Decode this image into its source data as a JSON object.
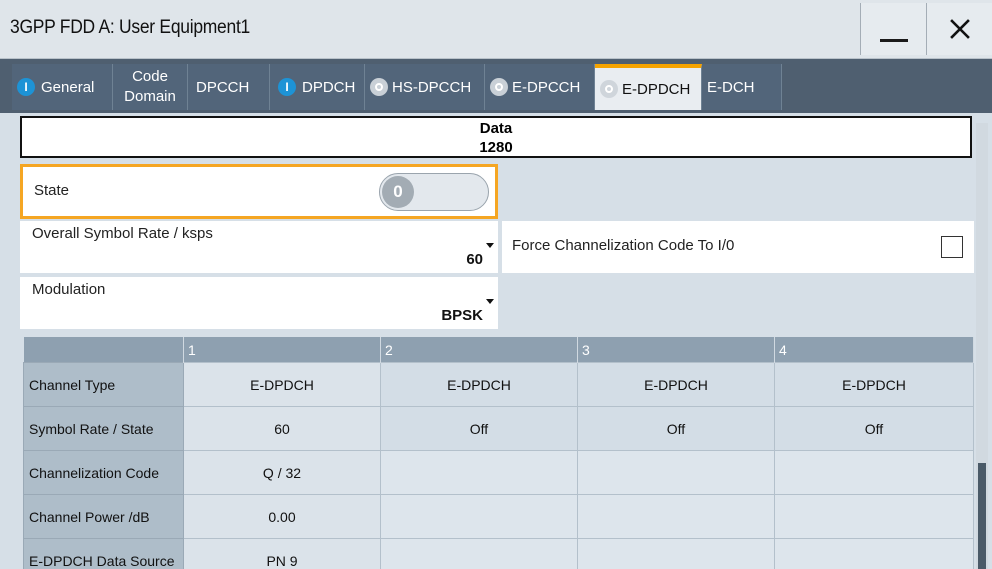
{
  "window": {
    "title": "3GPP FDD A: User Equipment1"
  },
  "tabs": [
    {
      "label": "General",
      "indicator": "on"
    },
    {
      "label_line1": "Code",
      "label_line2": "Domain"
    },
    {
      "label": "DPCCH"
    },
    {
      "label": "DPDCH",
      "indicator": "on"
    },
    {
      "label": "HS-DPCCH",
      "indicator": "off"
    },
    {
      "label": "E-DPCCH",
      "indicator": "off"
    },
    {
      "label": "E-DPDCH",
      "indicator": "off",
      "active": true
    },
    {
      "label": "E-DCH"
    }
  ],
  "indicator_on_text": "I",
  "indicator_off_text": "O",
  "data_display": {
    "line1": "Data",
    "line2": "1280"
  },
  "state": {
    "label": "State",
    "value": "0"
  },
  "symbol_rate": {
    "label": "Overall Symbol Rate / ksps",
    "value": "60"
  },
  "force_code": {
    "label": "Force Channelization Code To I/0",
    "checked": false
  },
  "modulation": {
    "label": "Modulation",
    "value": "BPSK"
  },
  "table": {
    "columns": [
      "1",
      "2",
      "3",
      "4"
    ],
    "rows": [
      {
        "label": "Channel Type",
        "values": [
          "E-DPDCH",
          "E-DPDCH",
          "E-DPDCH",
          "E-DPDCH"
        ]
      },
      {
        "label": "Symbol Rate / State",
        "values": [
          "60",
          "Off",
          "Off",
          "Off"
        ]
      },
      {
        "label": "Channelization Code",
        "values": [
          "Q / 32",
          "",
          "",
          ""
        ]
      },
      {
        "label": "Channel Power /dB",
        "values": [
          "0.00",
          "",
          "",
          ""
        ]
      },
      {
        "label": "E-DPDCH Data Source",
        "values": [
          "PN 9",
          "",
          "",
          ""
        ]
      }
    ]
  },
  "colors": {
    "accent": "#f5a300",
    "tab_bg": "#52657a",
    "indicator_on": "#1d93d6"
  }
}
